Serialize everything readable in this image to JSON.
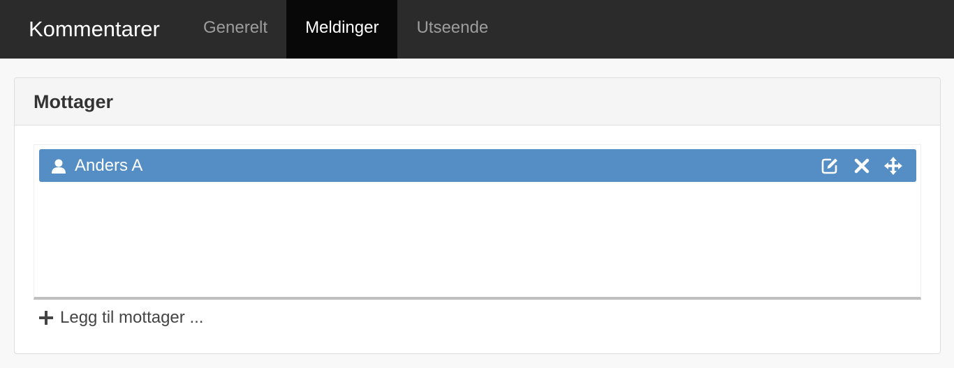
{
  "navbar": {
    "brand": "Kommentarer",
    "tabs": [
      {
        "label": "Generelt",
        "active": false
      },
      {
        "label": "Meldinger",
        "active": true
      },
      {
        "label": "Utseende",
        "active": false
      }
    ]
  },
  "panel": {
    "title": "Mottager",
    "recipients": [
      {
        "name": "Anders A",
        "icon": "user-icon",
        "actions": [
          "edit-icon",
          "remove-icon",
          "move-icon"
        ]
      }
    ],
    "add_label": "Legg til mottager ..."
  },
  "colors": {
    "navbar_bg": "#2b2b2b",
    "active_tab_bg": "#080808",
    "recipient_bg": "#548ec5"
  }
}
